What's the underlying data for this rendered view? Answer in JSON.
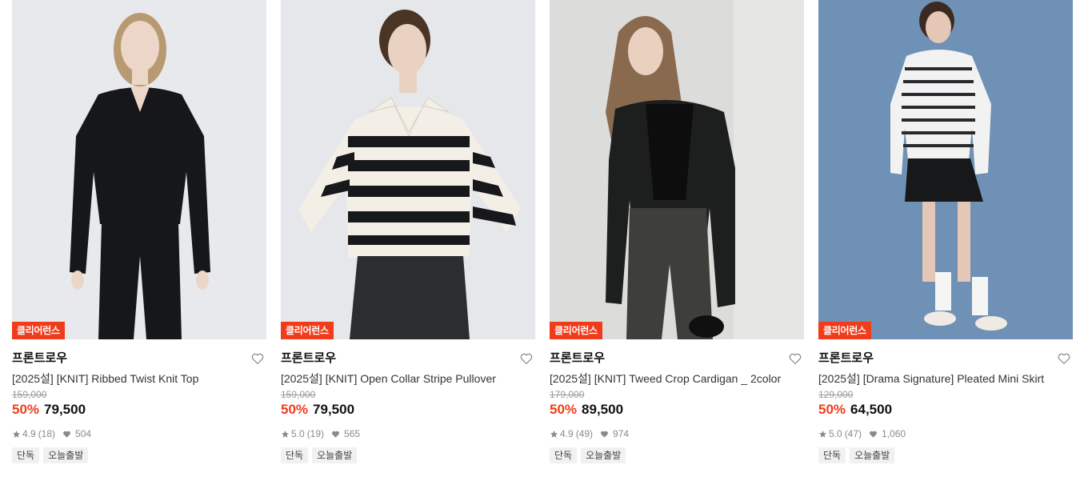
{
  "products": [
    {
      "badge": "클리어런스",
      "brand": "프론트로우",
      "title": "[2025설] [KNIT] Ribbed Twist Knit Top",
      "original_price": "159,000",
      "discount": "50%",
      "price": "79,500",
      "rating": "4.9",
      "reviews": "(18)",
      "likes": "504",
      "tags": [
        "단독",
        "오늘출발"
      ],
      "image": {
        "bg": "#e8e9ec",
        "garment": "#15171a",
        "bottom": "#15171a",
        "hair": "#b89a72",
        "skin": "#ecd6c8",
        "style": "knit-top"
      }
    },
    {
      "badge": "클리어런스",
      "brand": "프론트로우",
      "title": "[2025설] [KNIT] Open Collar Stripe Pullover",
      "original_price": "159,000",
      "discount": "50%",
      "price": "79,500",
      "rating": "5.0",
      "reviews": "(19)",
      "likes": "565",
      "tags": [
        "단독",
        "오늘출발"
      ],
      "image": {
        "bg": "#e6e7ea",
        "garment": "#f4efe6",
        "stripe": "#17181b",
        "bottom": "#2b2d30",
        "hair": "#4a3426",
        "skin": "#ead2c3",
        "style": "stripe"
      }
    },
    {
      "badge": "클리어런스",
      "brand": "프론트로우",
      "title": "[2025설] [KNIT] Tweed Crop Cardigan _ 2color",
      "original_price": "179,000",
      "discount": "50%",
      "price": "89,500",
      "rating": "4.9",
      "reviews": "(49)",
      "likes": "974",
      "tags": [
        "단독",
        "오늘출발"
      ],
      "image": {
        "bg": "#dcdcdb",
        "garment": "#1d1e1e",
        "bottom": "#3e3f3a",
        "hair": "#8a6a4e",
        "skin": "#ead0bf",
        "style": "cardigan"
      }
    },
    {
      "badge": "클리어런스",
      "brand": "프론트로우",
      "title": "[2025설] [Drama Signature] Pleated Mini Skirt",
      "original_price": "129,000",
      "discount": "50%",
      "price": "64,500",
      "rating": "5.0",
      "reviews": "(47)",
      "likes": "1,060",
      "tags": [
        "단독",
        "오늘출발"
      ],
      "image": {
        "bg": "#6f91b5",
        "garment": "#f2f2f2",
        "stripe": "#2a2a2e",
        "bottom": "#17181a",
        "hair": "#3c2a20",
        "skin": "#e4c7b6",
        "style": "skirt"
      }
    }
  ],
  "colors": {
    "accent": "#f03c1a",
    "muted": "#9b9b9b"
  },
  "icons": {
    "like": "heart-outline-icon",
    "rating": "star-icon",
    "likes": "heart-icon"
  }
}
